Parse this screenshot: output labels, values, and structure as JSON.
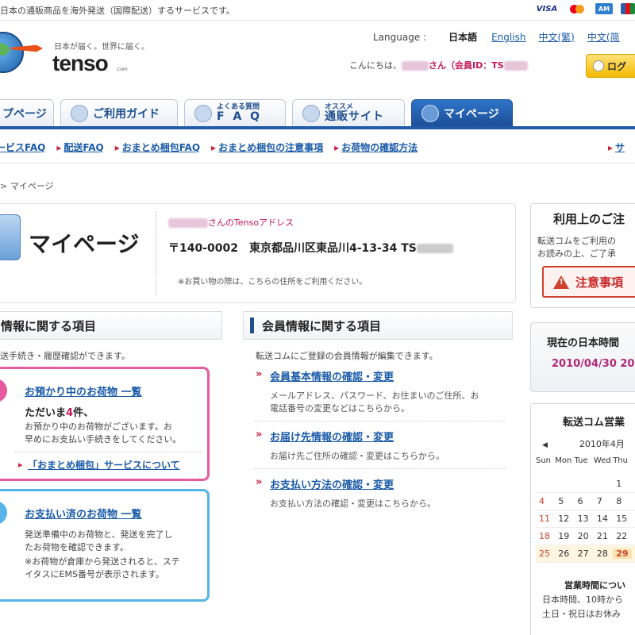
{
  "topbar": {
    "description": "日本の通販商品を海外発送（国際配送）するサービスです。",
    "cards": [
      "VISA",
      "MasterCard",
      "AMEX",
      "JCB"
    ]
  },
  "header": {
    "tagline": "日本が届く。世界に届く。",
    "logo_text": "tenso",
    "logo_suffix": ".com",
    "language_label": "Language :",
    "languages": {
      "current": "日本語",
      "english": "English",
      "zh_trad": "中文(繁)",
      "zh_simp": "中文(简"
    },
    "greeting_prefix": "こんにちは、",
    "greeting_suffix": "さん（会員ID：TS",
    "logout_label": "ログ"
  },
  "nav": {
    "tabs": [
      {
        "label": "プページ"
      },
      {
        "label": "ご利用ガイド"
      },
      {
        "small": "よくある質問",
        "big": "F A Q"
      },
      {
        "small": "オススメ",
        "big": "通販サイト"
      },
      {
        "label": "マイページ"
      }
    ]
  },
  "subnav": {
    "links": [
      "ービスFAQ",
      "配送FAQ",
      "おまとめ梱包FAQ",
      "おまとめ梱包の注意事項",
      "お荷物の確認方法",
      "サ"
    ]
  },
  "breadcrumb": "> マイページ",
  "mypage": {
    "title": "マイページ",
    "address_owner_suffix": "さんのTensoアドレス",
    "address": "〒140-0002　東京都品川区東品川4-13-34 TS",
    "note": "※お買い物の際は、こちらの住所をご利用ください。"
  },
  "left_section": {
    "title": "情報に関する項目",
    "desc": "送手続き・履歴確認ができます。",
    "pink_box": {
      "title": "お預かり中のお荷物 一覧",
      "count_prefix": "ただいま",
      "count": "4",
      "count_suffix": "件、",
      "line1": "お預かり中のお荷物がございます。お",
      "line2": "早めにお支払い手続きをしてください。",
      "link": "「おまとめ梱包」サービスについて"
    },
    "blue_box": {
      "title": "お支払い済のお荷物 一覧",
      "line1": "発送準備中のお荷物と、発送を完了し",
      "line2": "たお荷物を確認できます。",
      "line3": "※お荷物が倉庫から発送されると、ステ",
      "line4": "イタスにEMS番号が表示されます。"
    }
  },
  "member_section": {
    "title": "会員情報に関する項目",
    "desc": "転送コムにご登録の会員情報が編集できます。",
    "items": [
      {
        "link": "会員基本情報の確認・変更",
        "desc1": "メールアドレス、パスワード、お住まいのご住所、お",
        "desc2": "電話番号の変更などはこちらから。"
      },
      {
        "link": "お届け先情報の確認・変更",
        "desc1": "お届け先ご住所の確認・変更はこちらから。"
      },
      {
        "link": "お支払い方法の確認・変更",
        "desc1": "お支払い方法の確認・変更はこちらから。"
      }
    ]
  },
  "right": {
    "notice_title": "利用上のご注",
    "notice_line1": "転送コムをご利用の",
    "notice_line2": "お読みの上、ご了承",
    "alert_label": "注意事項",
    "time_title": "現在の日本時間",
    "time_value": "2010/04/30 20",
    "calendar_title": "転送コム営業",
    "calendar_month": "2010年4月",
    "weekdays": [
      "Sun",
      "Mon",
      "Tue",
      "Wed",
      "Thu"
    ],
    "rows": [
      [
        "",
        "",
        "",
        "",
        "1"
      ],
      [
        "4",
        "5",
        "6",
        "7",
        "8"
      ],
      [
        "11",
        "12",
        "13",
        "14",
        "15"
      ],
      [
        "18",
        "19",
        "20",
        "21",
        "22"
      ],
      [
        "25",
        "26",
        "27",
        "28",
        "29"
      ]
    ],
    "hours_title": "営業時間につい",
    "hours_line1": "日本時間、10時から",
    "hours_line2": "土日・祝日はお休み"
  }
}
